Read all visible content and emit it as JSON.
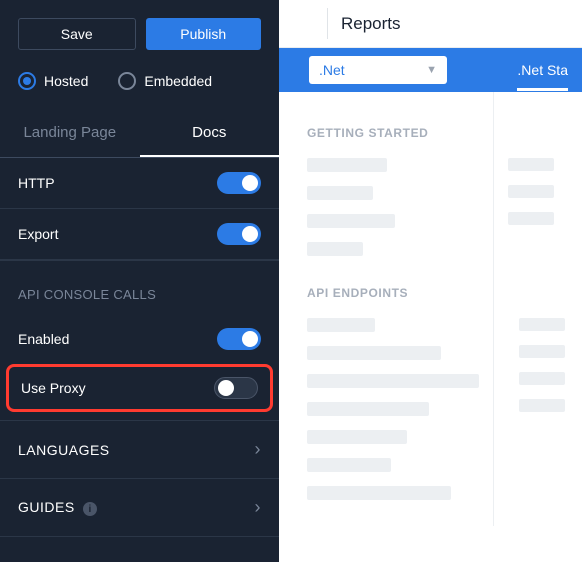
{
  "sidebar": {
    "buttons": {
      "save": "Save",
      "publish": "Publish"
    },
    "radios": {
      "hosted": "Hosted",
      "embedded": "Embedded",
      "selected": "hosted"
    },
    "tabs": {
      "landing": "Landing Page",
      "docs": "Docs",
      "active": "docs"
    },
    "toggles": {
      "http": {
        "label": "HTTP",
        "on": true
      },
      "export": {
        "label": "Export",
        "on": true
      }
    },
    "api_console": {
      "title": "API CONSOLE CALLS",
      "enabled": {
        "label": "Enabled",
        "on": true
      },
      "use_proxy": {
        "label": "Use Proxy",
        "on": false
      }
    },
    "expandables": {
      "languages": "LANGUAGES",
      "guides": "GUIDES"
    }
  },
  "main": {
    "title": "Reports",
    "toolbar": {
      "select_label": ".Net",
      "right_link": ".Net Sta"
    },
    "sections": {
      "getting_started": "GETTING STARTED",
      "api_endpoints": "API ENDPOINTS"
    }
  }
}
